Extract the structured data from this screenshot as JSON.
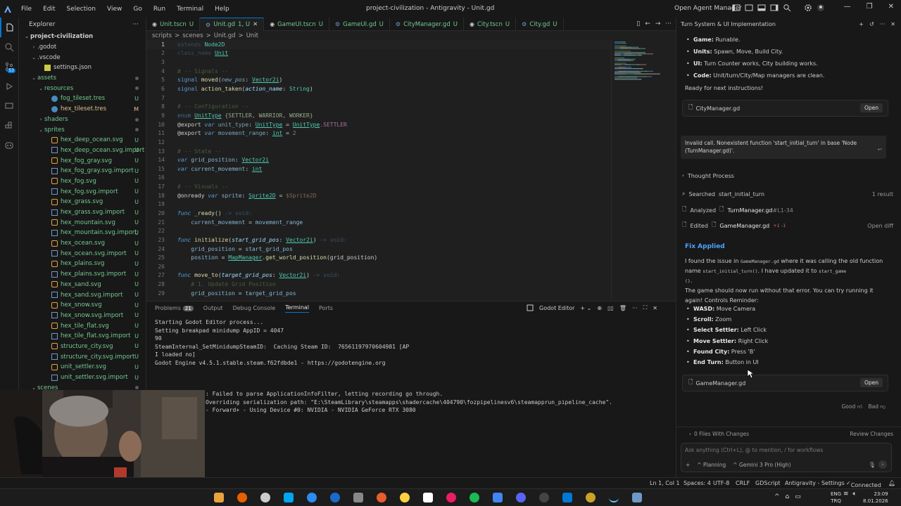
{
  "titlebar": {
    "menu": [
      "File",
      "Edit",
      "Selection",
      "View",
      "Go",
      "Run",
      "Terminal",
      "Help"
    ],
    "title": "project-civilization - Antigravity - Unit.gd",
    "open_agent_manager": "Open Agent Manager"
  },
  "activity": {
    "badge": "53"
  },
  "sidebar": {
    "title": "Explorer",
    "items": [
      {
        "label": "project-civilization",
        "depth": 0,
        "chev": "v",
        "kind": "root",
        "status": ""
      },
      {
        "label": ".godot",
        "depth": 1,
        "chev": ">",
        "kind": "folder",
        "status": ""
      },
      {
        "label": ".vscode",
        "depth": 1,
        "chev": "v",
        "kind": "folder",
        "status": ""
      },
      {
        "label": "settings.json",
        "depth": 2,
        "chev": "",
        "kind": "json",
        "status": ""
      },
      {
        "label": "assets",
        "depth": 1,
        "chev": "v",
        "kind": "folder",
        "status": "dot"
      },
      {
        "label": "resources",
        "depth": 2,
        "chev": "v",
        "kind": "folder",
        "status": "dot"
      },
      {
        "label": "fog_tileset.tres",
        "depth": 3,
        "chev": "",
        "kind": "res",
        "status": "U"
      },
      {
        "label": "hex_tileset.tres",
        "depth": 3,
        "chev": "",
        "kind": "res",
        "status": "M"
      },
      {
        "label": "shaders",
        "depth": 2,
        "chev": ">",
        "kind": "folder",
        "status": "dot"
      },
      {
        "label": "sprites",
        "depth": 2,
        "chev": "v",
        "kind": "folder",
        "status": "dot"
      },
      {
        "label": "hex_deep_ocean.svg",
        "depth": 3,
        "chev": "",
        "kind": "svg",
        "status": "U"
      },
      {
        "label": "hex_deep_ocean.svg.import",
        "depth": 3,
        "chev": "",
        "kind": "imp",
        "status": "U"
      },
      {
        "label": "hex_fog_gray.svg",
        "depth": 3,
        "chev": "",
        "kind": "svg",
        "status": "U"
      },
      {
        "label": "hex_fog_gray.svg.import",
        "depth": 3,
        "chev": "",
        "kind": "imp",
        "status": "U"
      },
      {
        "label": "hex_fog.svg",
        "depth": 3,
        "chev": "",
        "kind": "svg",
        "status": "U"
      },
      {
        "label": "hex_fog.svg.import",
        "depth": 3,
        "chev": "",
        "kind": "imp",
        "status": "U"
      },
      {
        "label": "hex_grass.svg",
        "depth": 3,
        "chev": "",
        "kind": "svg",
        "status": "U"
      },
      {
        "label": "hex_grass.svg.import",
        "depth": 3,
        "chev": "",
        "kind": "imp",
        "status": "U"
      },
      {
        "label": "hex_mountain.svg",
        "depth": 3,
        "chev": "",
        "kind": "svg",
        "status": "U"
      },
      {
        "label": "hex_mountain.svg.import",
        "depth": 3,
        "chev": "",
        "kind": "imp",
        "status": "U"
      },
      {
        "label": "hex_ocean.svg",
        "depth": 3,
        "chev": "",
        "kind": "svg",
        "status": "U"
      },
      {
        "label": "hex_ocean.svg.import",
        "depth": 3,
        "chev": "",
        "kind": "imp",
        "status": "U"
      },
      {
        "label": "hex_plains.svg",
        "depth": 3,
        "chev": "",
        "kind": "svg",
        "status": "U"
      },
      {
        "label": "hex_plains.svg.import",
        "depth": 3,
        "chev": "",
        "kind": "imp",
        "status": "U"
      },
      {
        "label": "hex_sand.svg",
        "depth": 3,
        "chev": "",
        "kind": "svg",
        "status": "U"
      },
      {
        "label": "hex_sand.svg.import",
        "depth": 3,
        "chev": "",
        "kind": "imp",
        "status": "U"
      },
      {
        "label": "hex_snow.svg",
        "depth": 3,
        "chev": "",
        "kind": "svg",
        "status": "U"
      },
      {
        "label": "hex_snow.svg.import",
        "depth": 3,
        "chev": "",
        "kind": "imp",
        "status": "U"
      },
      {
        "label": "hex_tile_flat.svg",
        "depth": 3,
        "chev": "",
        "kind": "svg",
        "status": "U"
      },
      {
        "label": "hex_tile_flat.svg.import",
        "depth": 3,
        "chev": "",
        "kind": "imp",
        "status": "U"
      },
      {
        "label": "structure_city.svg",
        "depth": 3,
        "chev": "",
        "kind": "svg",
        "status": "U"
      },
      {
        "label": "structure_city.svg.import",
        "depth": 3,
        "chev": "",
        "kind": "imp",
        "status": "U"
      },
      {
        "label": "unit_settler.svg",
        "depth": 3,
        "chev": "",
        "kind": "svg",
        "status": "U"
      },
      {
        "label": "unit_settler.svg.import",
        "depth": 3,
        "chev": "",
        "kind": "imp",
        "status": "U"
      },
      {
        "label": "scenes",
        "depth": 1,
        "chev": "v",
        "kind": "folder",
        "status": "dot"
      }
    ]
  },
  "tabs": [
    {
      "label": "Unit.tscn",
      "status": "U",
      "active": false
    },
    {
      "label": "Unit.gd",
      "status": "1, U",
      "active": true
    },
    {
      "label": "GameUI.tscn",
      "status": "U",
      "active": false
    },
    {
      "label": "GameUI.gd",
      "status": "U",
      "active": false
    },
    {
      "label": "CityManager.gd",
      "status": "U",
      "active": false
    },
    {
      "label": "City.tscn",
      "status": "U",
      "active": false
    },
    {
      "label": "City.gd",
      "status": "U",
      "active": false
    }
  ],
  "breadcrumb": [
    "scripts",
    ">",
    "scenes",
    ">",
    "Unit.gd",
    ">",
    "Unit"
  ],
  "code": [
    [
      {
        "t": "extends ",
        "c": "#569cd6",
        "o": 0.35
      },
      {
        "t": "Node2D",
        "c": "#4ec9b0"
      }
    ],
    [
      {
        "t": "class_name ",
        "c": "#569cd6",
        "o": 0.35
      },
      {
        "t": "Unit",
        "c": "#4ec9b0",
        "u": 1
      }
    ],
    [],
    [
      {
        "t": "# -- Signals --",
        "c": "#6a9955",
        "o": 0.5
      }
    ],
    [
      {
        "t": "signal ",
        "c": "#569cd6"
      },
      {
        "t": "moved",
        "c": "#dcdcaa"
      },
      {
        "t": "(",
        "c": "#ccc"
      },
      {
        "t": "new_pos",
        "c": "#9cdcfe",
        "i": 1,
        "o": 0.7
      },
      {
        "t": ": ",
        "c": "#ccc"
      },
      {
        "t": "Vector2i",
        "c": "#4ec9b0",
        "u": 1
      },
      {
        "t": ")",
        "c": "#ccc"
      }
    ],
    [
      {
        "t": "signal ",
        "c": "#569cd6"
      },
      {
        "t": "action_taken",
        "c": "#dcdcaa"
      },
      {
        "t": "(",
        "c": "#ccc"
      },
      {
        "t": "action_name",
        "c": "#9cdcfe",
        "i": 1
      },
      {
        "t": ": ",
        "c": "#ccc"
      },
      {
        "t": "String",
        "c": "#4ec9b0"
      },
      {
        "t": ")",
        "c": "#ccc"
      }
    ],
    [],
    [
      {
        "t": "# -- Configuration --",
        "c": "#6a9955",
        "o": 0.5
      }
    ],
    [
      {
        "t": "enum ",
        "c": "#569cd6",
        "o": 0.6
      },
      {
        "t": "UnitType",
        "c": "#4ec9b0",
        "u": 1
      },
      {
        "t": " {SETTLER, WARRIOR, WORKER}",
        "c": "#b5cea8",
        "o": 0.8
      }
    ],
    [
      {
        "t": "@export ",
        "c": "#cccccc"
      },
      {
        "t": "var ",
        "c": "#569cd6",
        "i": 1
      },
      {
        "t": "unit_type",
        "c": "#9cdcfe",
        "o": 0.7
      },
      {
        "t": ": ",
        "c": "#ccc"
      },
      {
        "t": "UnitType",
        "c": "#4ec9b0",
        "u": 1
      },
      {
        "t": " = ",
        "c": "#ccc"
      },
      {
        "t": "UnitType",
        "c": "#4ec9b0",
        "u": 1
      },
      {
        "t": ".SETTLER",
        "c": "#c586c0",
        "o": 0.8
      }
    ],
    [
      {
        "t": "@export ",
        "c": "#cccccc"
      },
      {
        "t": "var ",
        "c": "#569cd6",
        "i": 1
      },
      {
        "t": "movement_range",
        "c": "#9cdcfe",
        "o": 0.7
      },
      {
        "t": ": ",
        "c": "#ccc"
      },
      {
        "t": "int",
        "c": "#4ec9b0",
        "u": 1
      },
      {
        "t": " = ",
        "c": "#ccc"
      },
      {
        "t": "2",
        "c": "#b5cea8",
        "o": 0.6
      }
    ],
    [],
    [
      {
        "t": "# -- State --",
        "c": "#6a9955",
        "o": 0.5
      }
    ],
    [
      {
        "t": "var ",
        "c": "#569cd6",
        "i": 1
      },
      {
        "t": "grid_position",
        "c": "#9cdcfe",
        "o": 0.8
      },
      {
        "t": ": ",
        "c": "#ccc"
      },
      {
        "t": "Vector2i",
        "c": "#4ec9b0",
        "u": 1
      }
    ],
    [
      {
        "t": "var ",
        "c": "#569cd6",
        "i": 1
      },
      {
        "t": "current_movement",
        "c": "#9cdcfe",
        "o": 0.8
      },
      {
        "t": ": ",
        "c": "#ccc"
      },
      {
        "t": "int",
        "c": "#4ec9b0",
        "u": 1
      }
    ],
    [],
    [
      {
        "t": "# -- Visuals --",
        "c": "#6a9955",
        "o": 0.5
      }
    ],
    [
      {
        "t": "@onready ",
        "c": "#cccccc"
      },
      {
        "t": "var ",
        "c": "#569cd6",
        "i": 1
      },
      {
        "t": "sprite",
        "c": "#9cdcfe",
        "o": 0.8
      },
      {
        "t": ": ",
        "c": "#ccc"
      },
      {
        "t": "Sprite2D",
        "c": "#4ec9b0",
        "u": 1
      },
      {
        "t": " = ",
        "c": "#ccc"
      },
      {
        "t": "$Sprite2D",
        "c": "#ce9178",
        "o": 0.6
      }
    ],
    [],
    [
      {
        "t": "func ",
        "c": "#569cd6",
        "i": 1
      },
      {
        "t": "_ready",
        "c": "#dcdcaa"
      },
      {
        "t": "() ",
        "c": "#ccc"
      },
      {
        "t": "-> void:",
        "c": "#569cd6",
        "o": 0.4
      }
    ],
    [
      {
        "t": "    current_movement",
        "c": "#9cdcfe",
        "o": 0.8
      },
      {
        "t": " = ",
        "c": "#ccc"
      },
      {
        "t": "movement_range",
        "c": "#9cdcfe",
        "o": 0.8
      }
    ],
    [],
    [
      {
        "t": "func ",
        "c": "#569cd6",
        "i": 1
      },
      {
        "t": "initialize",
        "c": "#dcdcaa"
      },
      {
        "t": "(",
        "c": "#ccc"
      },
      {
        "t": "start_grid_pos",
        "c": "#9cdcfe",
        "i": 1
      },
      {
        "t": ": ",
        "c": "#ccc"
      },
      {
        "t": "Vector2i",
        "c": "#4ec9b0",
        "u": 1
      },
      {
        "t": ") ",
        "c": "#ccc"
      },
      {
        "t": "-> void:",
        "c": "#569cd6",
        "o": 0.4
      }
    ],
    [
      {
        "t": "    grid_position",
        "c": "#9cdcfe",
        "o": 0.8
      },
      {
        "t": " = ",
        "c": "#ccc"
      },
      {
        "t": "start_grid_pos",
        "c": "#9cdcfe",
        "o": 0.8
      }
    ],
    [
      {
        "t": "    position",
        "c": "#9cdcfe",
        "o": 0.8
      },
      {
        "t": " = ",
        "c": "#ccc"
      },
      {
        "t": "MapManager",
        "c": "#4ec9b0",
        "u": 1
      },
      {
        "t": ".",
        "c": "#ccc"
      },
      {
        "t": "get_world_position",
        "c": "#dcdcaa"
      },
      {
        "t": "(grid_position)",
        "c": "#ccc"
      }
    ],
    [],
    [
      {
        "t": "func ",
        "c": "#569cd6",
        "i": 1
      },
      {
        "t": "move_to",
        "c": "#dcdcaa"
      },
      {
        "t": "(",
        "c": "#ccc"
      },
      {
        "t": "target_grid_pos",
        "c": "#9cdcfe",
        "i": 1
      },
      {
        "t": ": ",
        "c": "#ccc"
      },
      {
        "t": "Vector2i",
        "c": "#4ec9b0",
        "u": 1
      },
      {
        "t": ") ",
        "c": "#ccc"
      },
      {
        "t": "-> void:",
        "c": "#569cd6",
        "o": 0.4
      }
    ],
    [
      {
        "t": "    # 1. Update Grid Position",
        "c": "#6a9955",
        "o": 0.5
      }
    ],
    [
      {
        "t": "    grid_position",
        "c": "#9cdcfe",
        "o": 0.8
      },
      {
        "t": " = ",
        "c": "#ccc"
      },
      {
        "t": "target_grid_pos",
        "c": "#9cdcfe",
        "o": 0.8
      }
    ]
  ],
  "panel": {
    "tabs": [
      {
        "label": "Problems",
        "badge": "21"
      },
      {
        "label": "Output"
      },
      {
        "label": "Debug Console"
      },
      {
        "label": "Terminal",
        "active": true
      },
      {
        "label": "Ports"
      }
    ],
    "shell": "Godot Editor",
    "terminal_top": [
      "Starting Godot Editor process...",
      "Setting breakpad minidump AppID = 4047",
      "90",
      "",
      "SteamInternal_SetMinidumpSteamID:  Caching Steam ID:  76561197970604981 [AP",
      "I loaded no]",
      "",
      "Godot Engine v4.5.1.stable.steam.f62fdbde1 - https://godotengine.org"
    ],
    "terminal_bottom": [
      ": Failed to parse ApplicationInfoFilter, letting recording go through.",
      "",
      "Overriding serialization path: \"E:\\SteamLibrary\\steamapps\\shadercache\\404790\\fozpipelinesv6\\steamapprun_pipeline_cache\".",
      "",
      "- Forward+ - Using Device #0: NVIDIA - NVIDIA GeForce RTX 3080"
    ]
  },
  "agent": {
    "title": "Turn System & UI Implementation",
    "summary": [
      {
        "k": "Game:",
        "v": " Runable."
      },
      {
        "k": "Units:",
        "v": " Spawn, Move, Build City."
      },
      {
        "k": "UI:",
        "v": " Turn Counter works, City building works."
      },
      {
        "k": "Code:",
        "v": " Unit/turn/City/Map managers are clean."
      }
    ],
    "ready": "Ready for next instructions!",
    "file1": "CityManager.gd",
    "open": "Open",
    "user_msg": "Invalid call. Nonexistent function 'start_initial_turn' in base 'Node (TurnManager.gd)'.",
    "thought": "Thought Process",
    "searched": "Searched",
    "searched_q": "start_initial_turn",
    "searched_res": "1 result",
    "analyzed": "Analyzed",
    "analyzed_file": "TurnManager.gd",
    "analyzed_range": "#L1-34",
    "edited": "Edited",
    "edited_file": "GameManager.gd",
    "edited_diff": "+1 -1",
    "open_diff": "Open diff",
    "fix_title": "Fix Applied",
    "fix_p1a": "I found the issue in ",
    "fix_p1_code1": "GameManager.gd",
    "fix_p1b": " where it was calling the old function name ",
    "fix_p1_code2": "start_initial_turn()",
    "fix_p1c": ". I have updated it to ",
    "fix_p1_code3": "start_game",
    "fix_p1_code3b": "()",
    "fix_p1d": ".",
    "fix_p2": "The game should now run without that error. You can try running it again! Controls Reminder:",
    "controls": [
      {
        "k": "WASD:",
        "v": " Move Camera"
      },
      {
        "k": "Scroll:",
        "v": " Zoom"
      },
      {
        "k": "Select Settler:",
        "v": " Left Click"
      },
      {
        "k": "Move Settler:",
        "v": " Right Click"
      },
      {
        "k": "Found City:",
        "v": " Press 'B'"
      },
      {
        "k": "End Turn:",
        "v": " Button in UI"
      }
    ],
    "file2": "GameManager.gd",
    "good": "Good",
    "bad": "Bad",
    "files_changes": "0 Files With Changes",
    "review": "Review Changes",
    "placeholder": "Ask anything (Ctrl+L), @ to mention, / for workflows",
    "planning": "Planning",
    "model": "Gemini 3 Pro (High)"
  },
  "status": {
    "pos": "Ln 1, Col 1",
    "spaces": "Spaces: 4",
    "enc": "UTF-8",
    "eol": "CRLF",
    "lang": "GDScript",
    "settings": "Antigravity - Settings",
    "conn": "Connected"
  },
  "taskbar": {
    "lang1": "ENG",
    "lang2": "TRQ",
    "time": "23:09",
    "date": "8.01.2026"
  },
  "colors": {
    "accent": "#0078d4",
    "untracked": "#73c991",
    "modified": "#e2c08d",
    "fix_title": "#4aa3ff"
  }
}
